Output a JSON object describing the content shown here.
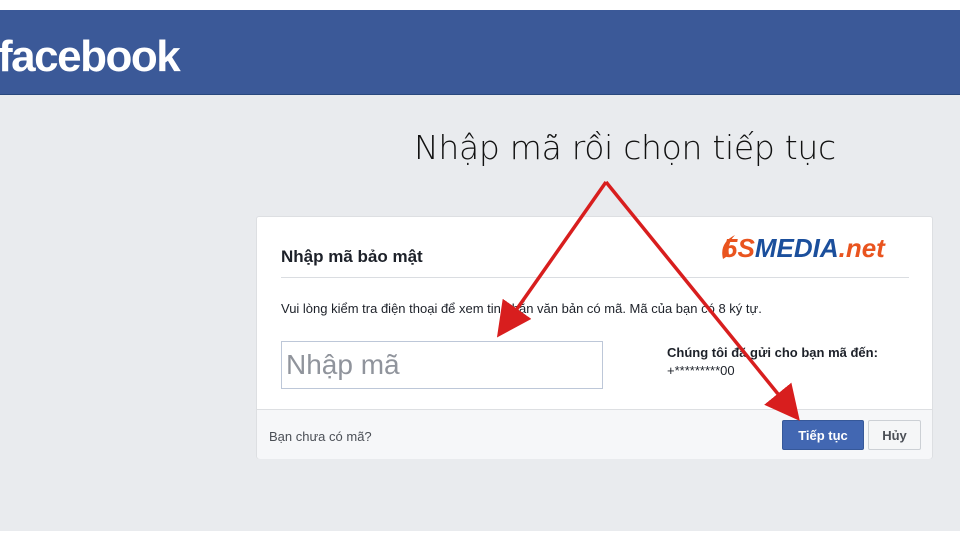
{
  "header": {
    "logo_text": "facebook",
    "color": "#3b5998"
  },
  "annotation": {
    "text": "Nhập mã rồi chọn tiếp tục",
    "arrow_color": "#d81e1e"
  },
  "brand": {
    "prefix": "5S",
    "name": "MEDIA",
    "suffix": ".net",
    "prefix_color": "#e9541f",
    "name_color": "#1b4f9c"
  },
  "dialog": {
    "title": "Nhập mã bảo mật",
    "instructions": "Vui lòng kiểm tra điện thoại để xem tin nhắn văn bản có mã. Mã của bạn có 8 ký tự.",
    "code_input": {
      "placeholder": "Nhập mã",
      "value": ""
    },
    "sent_label": "Chúng tôi đã gửi cho bạn mã đến:",
    "sent_number": "+*********00",
    "no_code_link": "Bạn chưa có mã?",
    "continue_label": "Tiếp tục",
    "cancel_label": "Hủy"
  }
}
